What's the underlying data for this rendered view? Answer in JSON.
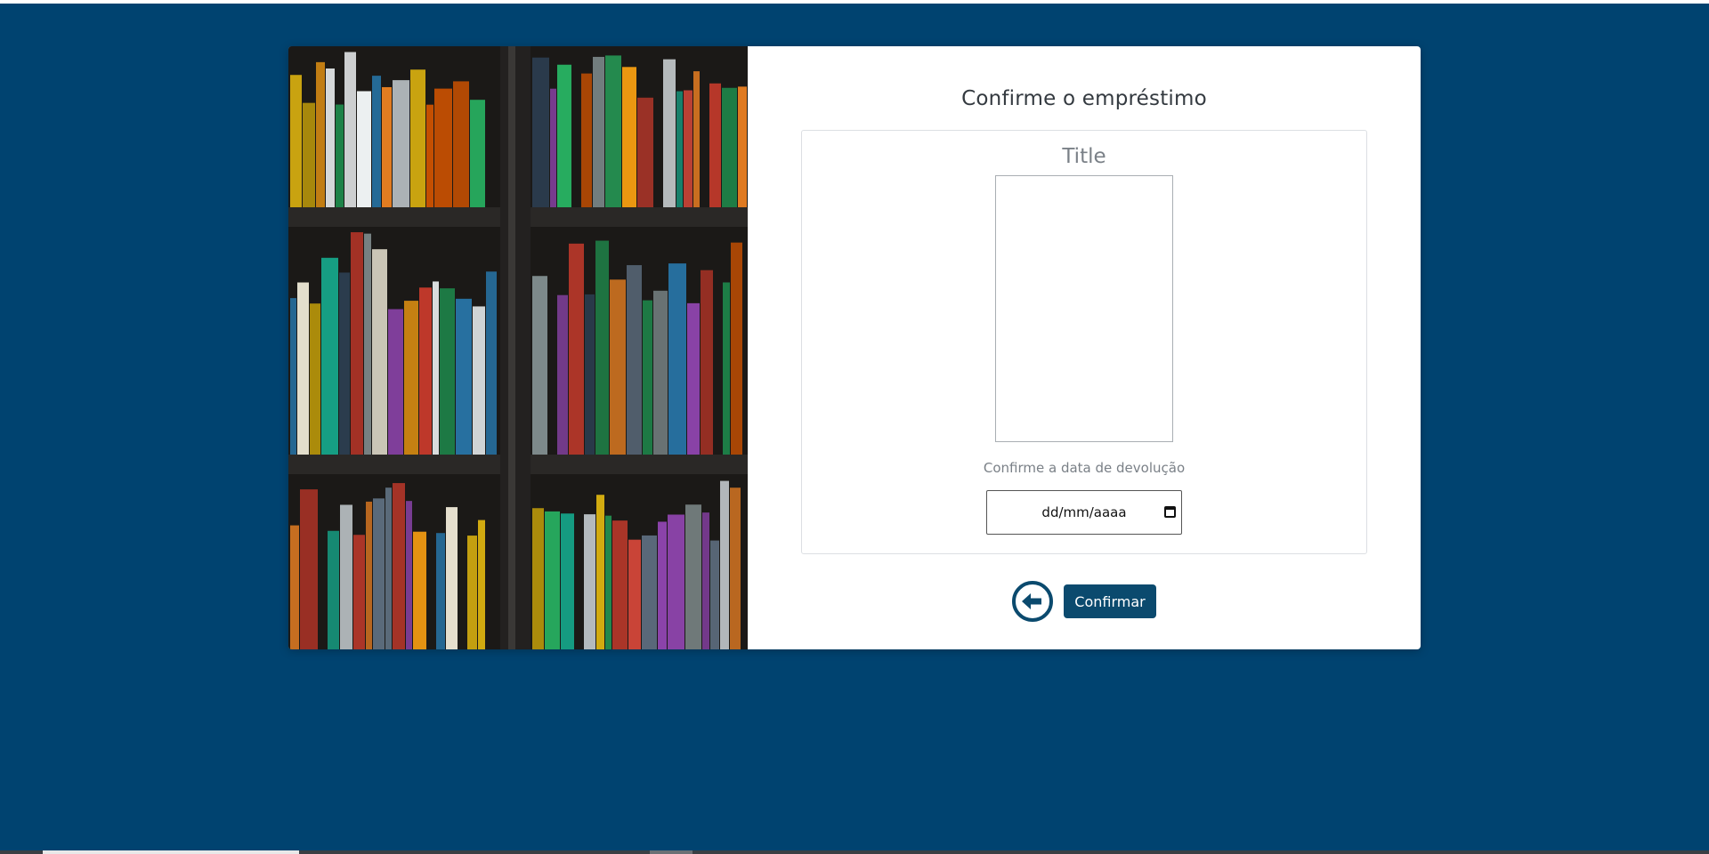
{
  "page": {
    "heading": "Confirme o empréstimo",
    "colors": {
      "background": "#004370",
      "accent": "#0b4a6e"
    }
  },
  "book": {
    "title": "Title",
    "cover_image": "book-cover-placeholder"
  },
  "return_date": {
    "label": "Confirme a data de devolução",
    "placeholder": "dd/mm/aaaa",
    "icon": "calendar-icon"
  },
  "actions": {
    "back_icon": "arrow-left-circle-icon",
    "confirm_label": "Confirmar"
  },
  "photo": {
    "description_icon": "bookshelf-photo"
  }
}
